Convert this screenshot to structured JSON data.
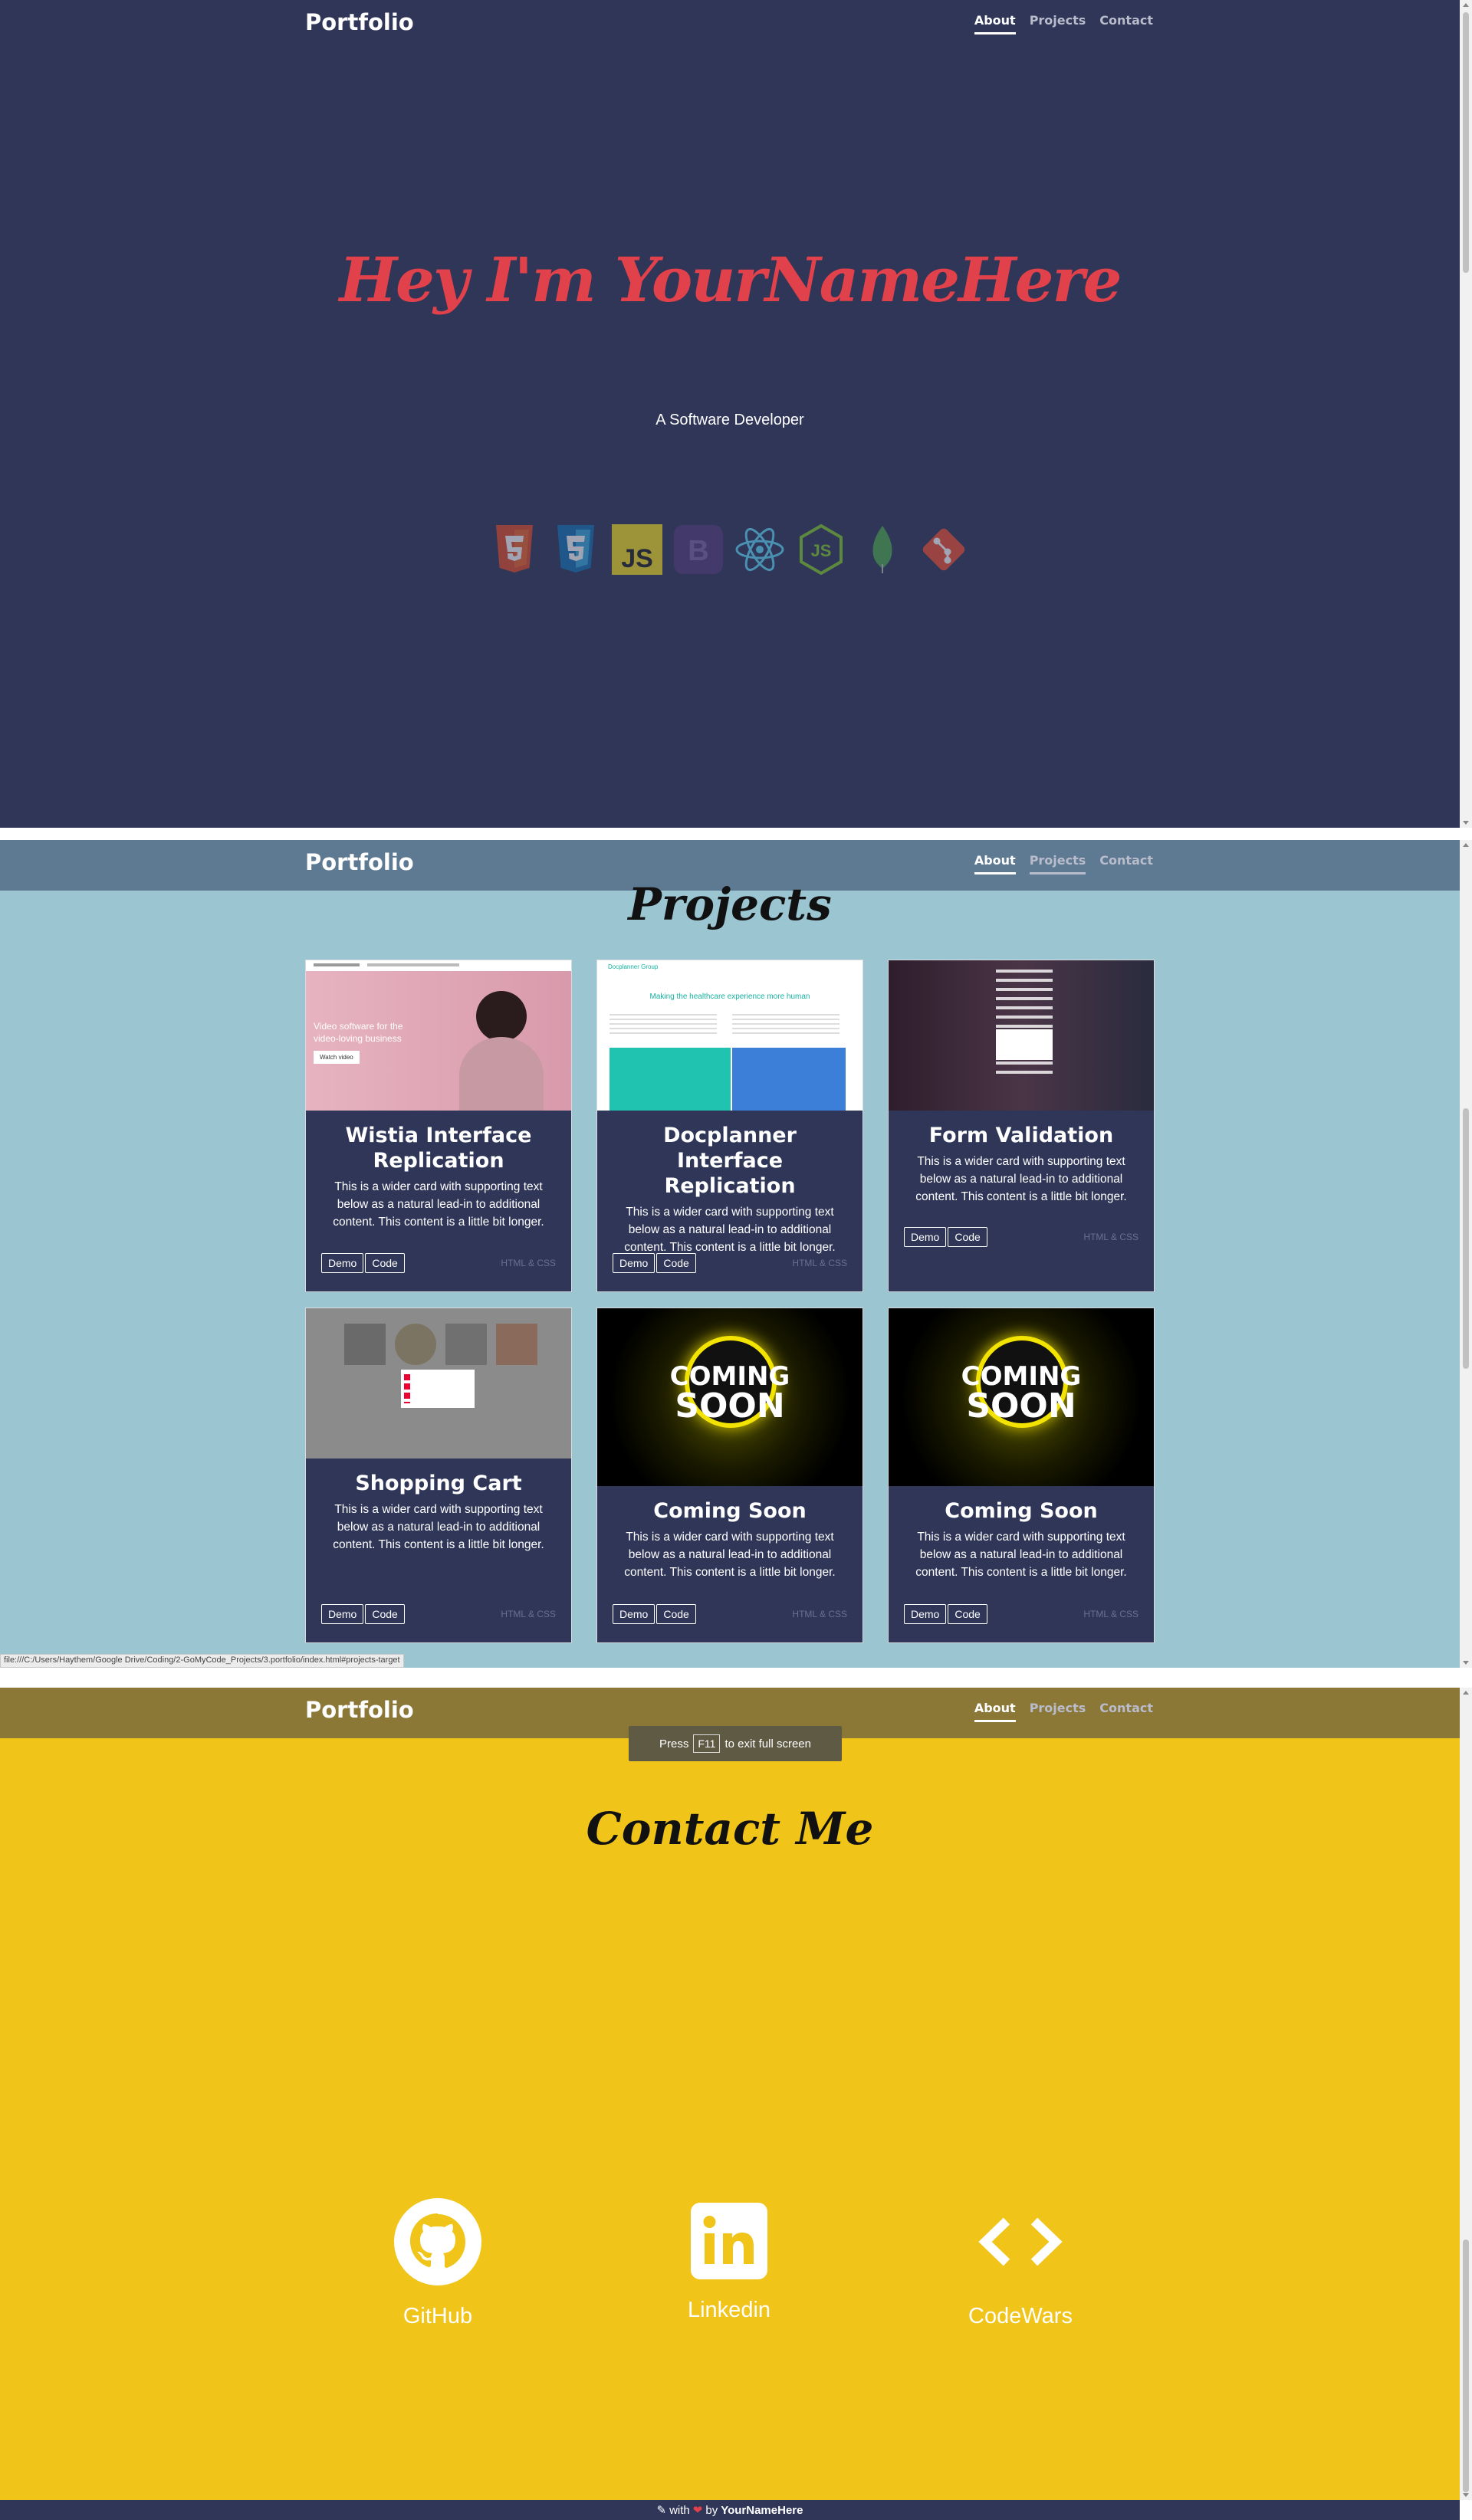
{
  "navbar": {
    "brand": "Portfolio",
    "links": [
      "About",
      "Projects",
      "Contact"
    ]
  },
  "hero": {
    "title": "Hey I'm YourNameHere",
    "subtitle": "A Software Developer",
    "tech_icons": [
      "html5-icon",
      "css3-icon",
      "javascript-icon",
      "bootstrap-icon",
      "react-icon",
      "nodejs-icon",
      "mongodb-icon",
      "git-icon"
    ]
  },
  "projects": {
    "title": "Projects",
    "cards": [
      {
        "title": "Wistia Interface Replication",
        "text": "This is a wider card with supporting text below as a natural lead-in to additional content. This content is a little bit longer.",
        "demo": "Demo",
        "code": "Code",
        "tag": "HTML & CSS",
        "thumb_text": "Video software for the video-loving business",
        "thumb_button": "Watch video"
      },
      {
        "title": "Docplanner Interface Replication",
        "text": "This is a wider card with supporting text below as a natural lead-in to additional content. This content is a little bit longer.",
        "demo": "Demo",
        "code": "Code",
        "tag": "HTML & CSS",
        "thumb_text": "Making the healthcare experience more human",
        "thumb_brand": "Docplanner Group"
      },
      {
        "title": "Form Validation",
        "text": "This is a wider card with supporting text below as a natural lead-in to additional content. This content is a little bit longer.",
        "demo": "Demo",
        "code": "Code",
        "tag": "HTML & CSS"
      },
      {
        "title": "Shopping Cart",
        "text": "This is a wider card with supporting text below as a natural lead-in to additional content. This content is a little bit longer.",
        "demo": "Demo",
        "code": "Code",
        "tag": "HTML & CSS"
      },
      {
        "title": "Coming Soon",
        "text": "This is a wider card with supporting text below as a natural lead-in to additional content. This content is a little bit longer.",
        "demo": "Demo",
        "code": "Code",
        "tag": "HTML & CSS",
        "badge": [
          "COMING",
          "SOON"
        ]
      },
      {
        "title": "Coming Soon",
        "text": "This is a wider card with supporting text below as a natural lead-in to additional content. This content is a little bit longer.",
        "demo": "Demo",
        "code": "Code",
        "tag": "HTML & CSS",
        "badge": [
          "COMING",
          "SOON"
        ]
      }
    ]
  },
  "status_url": "file:///C:/Users/Haythem/Google Drive/Coding/2-GoMyCode_Projects/3.portfolio/index.html#projects-target",
  "fullscreen_toast": {
    "press": "Press",
    "key": "F11",
    "rest": "to exit full screen"
  },
  "contact": {
    "title": "Contact Me",
    "links": [
      {
        "label": "GitHub",
        "icon": "github-icon"
      },
      {
        "label": "Linkedin",
        "icon": "linkedin-icon"
      },
      {
        "label": "CodeWars",
        "icon": "code-icon"
      }
    ]
  },
  "footer": {
    "with": "with",
    "by": "by",
    "name": "YourNameHere"
  },
  "colors": {
    "navy": "#2f3658",
    "red": "#e0414a",
    "sky": "#9ac5d1",
    "yellow": "#f0c419"
  }
}
